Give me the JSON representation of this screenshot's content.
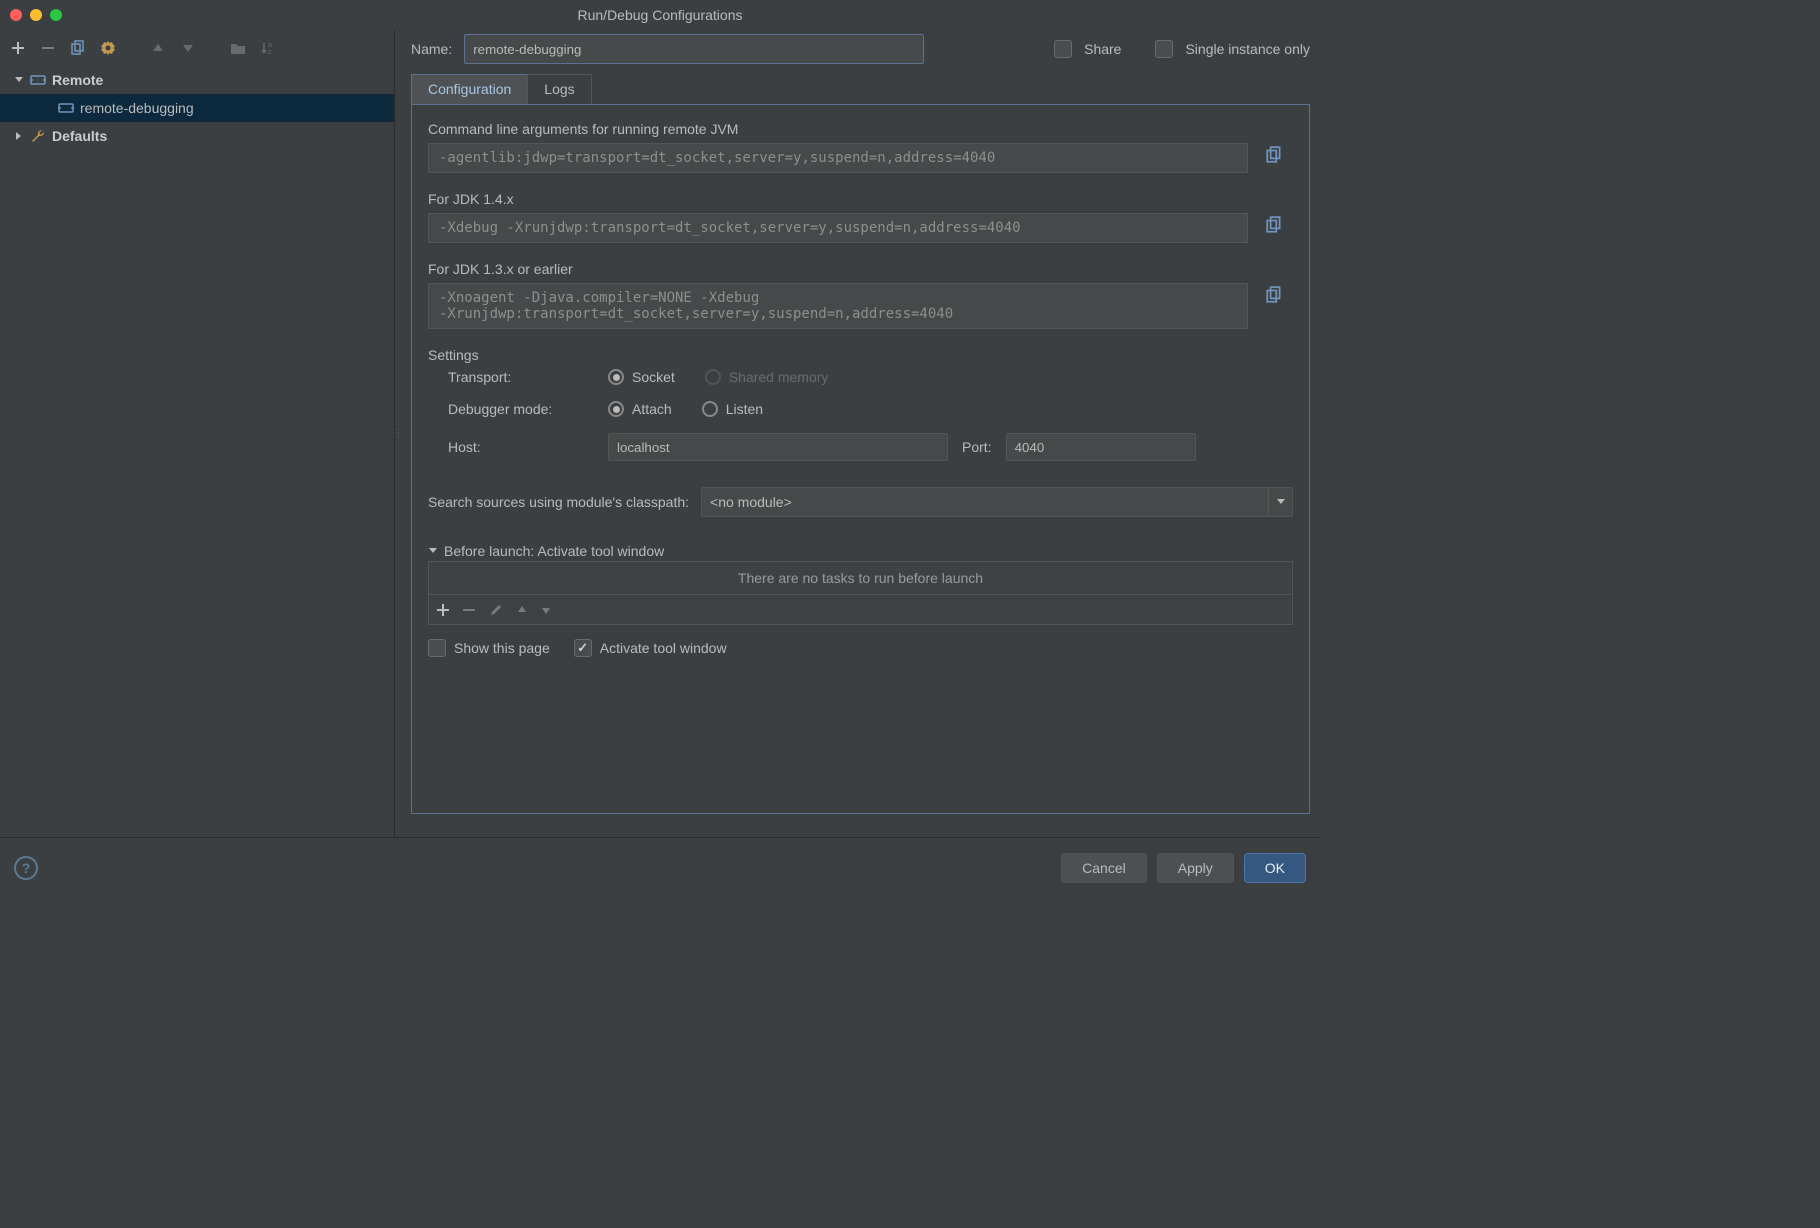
{
  "window": {
    "title": "Run/Debug Configurations"
  },
  "sidebar": {
    "items": [
      {
        "label": "Remote",
        "type": "category"
      },
      {
        "label": "remote-debugging",
        "type": "config"
      },
      {
        "label": "Defaults",
        "type": "category"
      }
    ]
  },
  "header": {
    "name_label": "Name:",
    "name_value": "remote-debugging",
    "share_label": "Share",
    "single_instance_label": "Single instance only"
  },
  "tabs": {
    "configuration": "Configuration",
    "logs": "Logs"
  },
  "config": {
    "cmdline_label": "Command line arguments for running remote JVM",
    "cmdline_value": "-agentlib:jdwp=transport=dt_socket,server=y,suspend=n,address=4040",
    "jdk14_label": "For JDK 1.4.x",
    "jdk14_value": "-Xdebug -Xrunjdwp:transport=dt_socket,server=y,suspend=n,address=4040",
    "jdk13_label": "For JDK 1.3.x or earlier",
    "jdk13_value": "-Xnoagent -Djava.compiler=NONE -Xdebug\n-Xrunjdwp:transport=dt_socket,server=y,suspend=n,address=4040",
    "settings_label": "Settings",
    "transport_label": "Transport:",
    "transport_socket": "Socket",
    "transport_shared": "Shared memory",
    "debugger_mode_label": "Debugger mode:",
    "mode_attach": "Attach",
    "mode_listen": "Listen",
    "host_label": "Host:",
    "host_value": "localhost",
    "port_label": "Port:",
    "port_value": "4040",
    "search_label": "Search sources using module's classpath:",
    "module_value": "<no module>",
    "before_launch_label": "Before launch: Activate tool window",
    "no_tasks": "There are no tasks to run before launch",
    "show_page_label": "Show this page",
    "activate_tool_label": "Activate tool window"
  },
  "footer": {
    "cancel": "Cancel",
    "apply": "Apply",
    "ok": "OK"
  }
}
